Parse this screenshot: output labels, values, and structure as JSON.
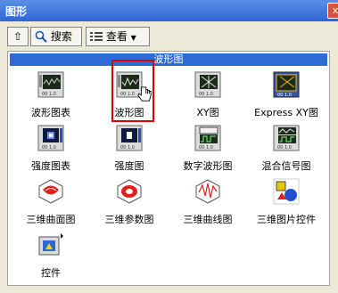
{
  "window": {
    "title": "图形",
    "close_label": "x"
  },
  "toolbar": {
    "up_label": "⇧",
    "search_label": "搜索",
    "view_label": "查看"
  },
  "panel": {
    "header": "波形图"
  },
  "items": [
    {
      "label": "波形图表",
      "icon": "waveform-chart-icon"
    },
    {
      "label": "波形图",
      "icon": "waveform-graph-icon",
      "selected": true
    },
    {
      "label": "XY图",
      "icon": "xy-graph-icon"
    },
    {
      "label": "Express XY图",
      "icon": "express-xy-graph-icon"
    },
    {
      "label": "强度图表",
      "icon": "intensity-chart-icon"
    },
    {
      "label": "强度图",
      "icon": "intensity-graph-icon"
    },
    {
      "label": "数字波形图",
      "icon": "digital-waveform-graph-icon"
    },
    {
      "label": "混合信号图",
      "icon": "mixed-signal-graph-icon"
    },
    {
      "label": "三维曲面图",
      "icon": "3d-surface-graph-icon"
    },
    {
      "label": "三维参数图",
      "icon": "3d-parametric-graph-icon"
    },
    {
      "label": "三维曲线图",
      "icon": "3d-curve-graph-icon"
    },
    {
      "label": "三维图片控件",
      "icon": "3d-picture-control-icon"
    },
    {
      "label": "控件",
      "icon": "controls-icon"
    }
  ]
}
